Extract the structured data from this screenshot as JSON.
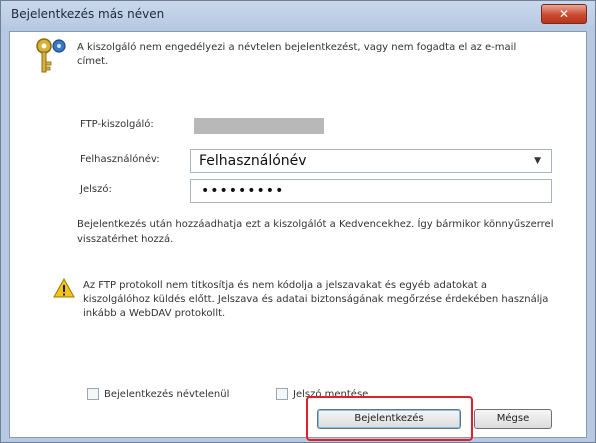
{
  "window": {
    "title": "Bejelentkezés más néven",
    "close_glyph": "✕"
  },
  "message": "A kiszolgáló nem engedélyezi a névtelen bejelentkezést, vagy nem fogadta el az e-mail címet.",
  "fields": {
    "server_label": "FTP-kiszolgáló:",
    "username_label": "Felhasználónév:",
    "username_value": "Felhasználónév",
    "password_label": "Jelszó:",
    "password_value": "•••••••••"
  },
  "info_text": "Bejelentkezés után hozzáadhatja ezt a kiszolgálót a Kedvencekhez. Így bármikor könnyűszerrel visszatérhet hozzá.",
  "warning_text": "Az FTP protokoll nem titkosítja és nem kódolja a jelszavakat és egyéb adatokat a kiszolgálóhoz küldés előtt. Jelszava és adatai biztonságának megőrzése érdekében használja inkább a WebDAV protokollt.",
  "checkboxes": {
    "anonymous_label": "Bejelentkezés névtelenül",
    "save_password_label": "Jelszó mentése"
  },
  "buttons": {
    "login": "Bejelentkezés",
    "cancel": "Mégse"
  },
  "icons": {
    "key": "key-icon",
    "warning": "warning-icon",
    "dropdown": "chevron-down-icon"
  },
  "colors": {
    "highlight_border": "#e0202a",
    "close_button": "#c9492f"
  }
}
